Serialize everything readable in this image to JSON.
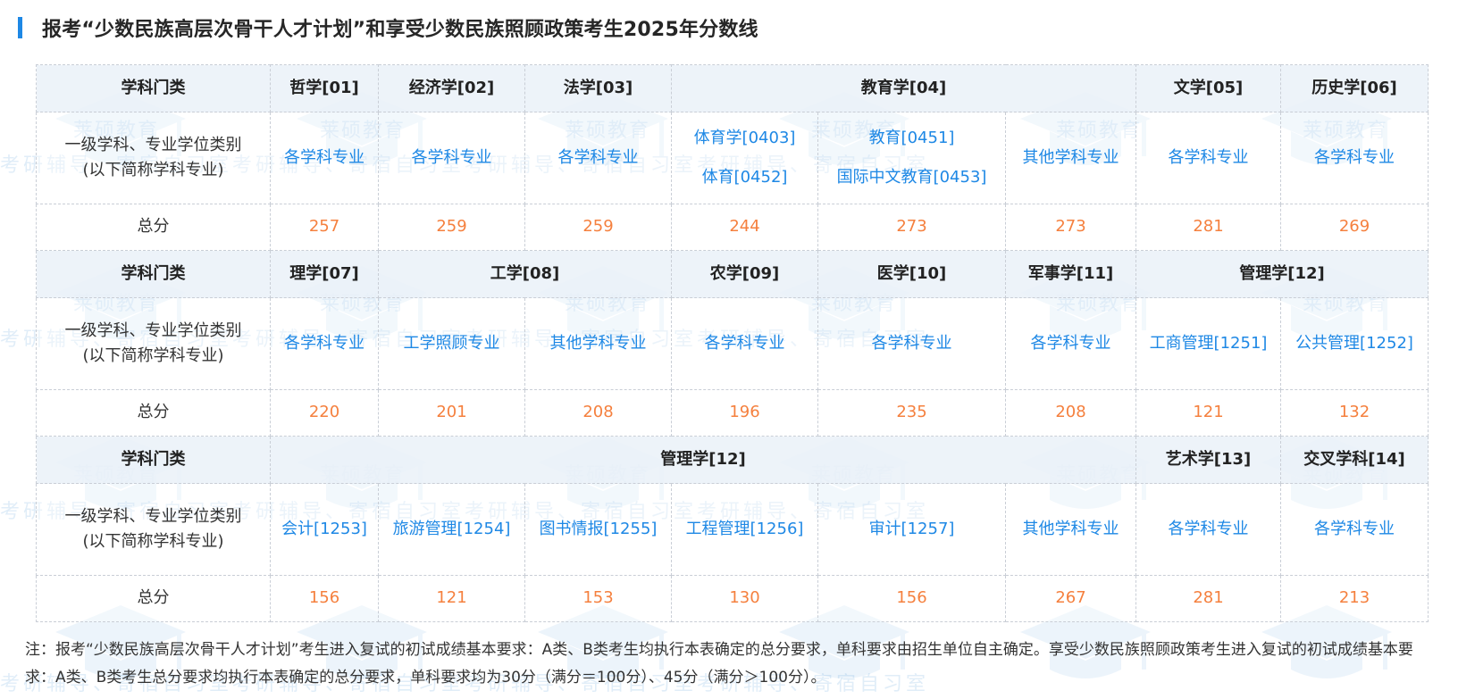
{
  "title": "报考“少数民族高层次骨干人才计划”和享受少数民族照顾政策考生2025年分数线",
  "watermark": {
    "brand": "莱硕教育",
    "line": "考研辅导、寄宿自习室考研辅导、寄宿自习室考研辅导、寄宿自习室考研辅导、寄宿自习室"
  },
  "row_labels": {
    "category": "学科门类",
    "subject_line1": "一级学科、专业学位类别",
    "subject_line2": "(以下简称学科专业)",
    "total": "总分"
  },
  "table": {
    "section1": {
      "categories": [
        "哲学[01]",
        "经济学[02]",
        "法学[03]",
        "教育学[04]",
        "文学[05]",
        "历史学[06]"
      ],
      "subjects": [
        "各学科专业",
        "各学科专业",
        "各学科专业",
        "体育学[0403]",
        "体育[0452]",
        "教育[0451]",
        "国际中文教育[0453]",
        "其他学科专业",
        "各学科专业",
        "各学科专业"
      ],
      "scores": [
        "257",
        "259",
        "259",
        "244",
        "273",
        "273",
        "281",
        "269"
      ]
    },
    "section2": {
      "categories": [
        "理学[07]",
        "工学[08]",
        "农学[09]",
        "医学[10]",
        "军事学[11]",
        "管理学[12]"
      ],
      "subjects": [
        "各学科专业",
        "工学照顾专业",
        "其他学科专业",
        "各学科专业",
        "各学科专业",
        "各学科专业",
        "工商管理[1251]",
        "公共管理[1252]"
      ],
      "scores": [
        "220",
        "201",
        "208",
        "196",
        "235",
        "208",
        "121",
        "132"
      ]
    },
    "section3": {
      "categories": [
        "管理学[12]",
        "艺术学[13]",
        "交叉学科[14]"
      ],
      "subjects": [
        "会计[1253]",
        "旅游管理[1254]",
        "图书情报[1255]",
        "工程管理[1256]",
        "审计[1257]",
        "其他学科专业",
        "各学科专业",
        "各学科专业"
      ],
      "scores": [
        "156",
        "121",
        "153",
        "130",
        "156",
        "267",
        "281",
        "213"
      ]
    }
  },
  "note": "注：报考“少数民族高层次骨干人才计划”考生进入复试的初试成绩基本要求：A类、B类考生均执行本表确定的总分要求，单科要求由招生单位自主确定。享受少数民族照顾政策考生进入复试的初试成绩基本要求：A类、B类考生总分要求均执行本表确定的总分要求，单科要求均为30分（满分＝100分）、45分（满分＞100分）。",
  "colors": {
    "accent": "#1e88e5",
    "subject_text": "#1e88e5",
    "score_text": "#f5803e",
    "header_bg": "#ebf1f8"
  }
}
